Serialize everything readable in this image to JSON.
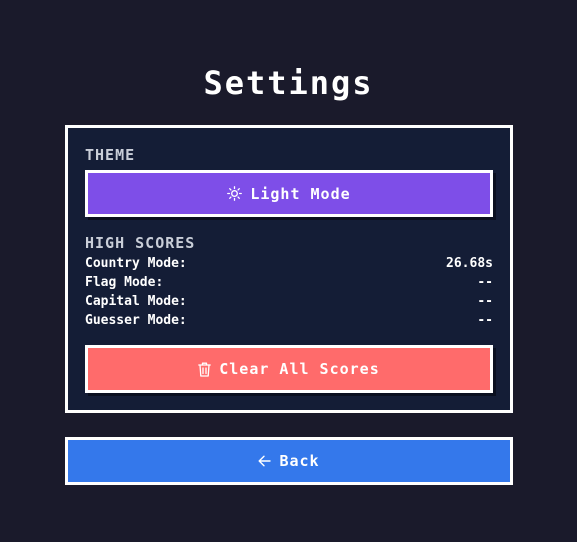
{
  "page": {
    "title": "Settings"
  },
  "theme": {
    "section_label": "THEME",
    "button_label": "Light Mode",
    "button_icon": "sun-icon",
    "button_color": "#7e4ee8"
  },
  "high_scores": {
    "section_label": "HIGH SCORES",
    "rows": [
      {
        "mode": "Country Mode:",
        "score": "26.68s"
      },
      {
        "mode": "Flag Mode:",
        "score": "--"
      },
      {
        "mode": "Capital Mode:",
        "score": "--"
      },
      {
        "mode": "Guesser Mode:",
        "score": "--"
      }
    ],
    "clear_label": "Clear All Scores",
    "clear_icon": "trash-icon",
    "clear_color": "#ff6b6b"
  },
  "navigation": {
    "back_label": "Back",
    "back_icon": "arrow-left-icon",
    "back_color": "#3478eb"
  },
  "colors": {
    "background": "#1a1a2b",
    "panel": "#141d36",
    "border": "#ffffff"
  }
}
